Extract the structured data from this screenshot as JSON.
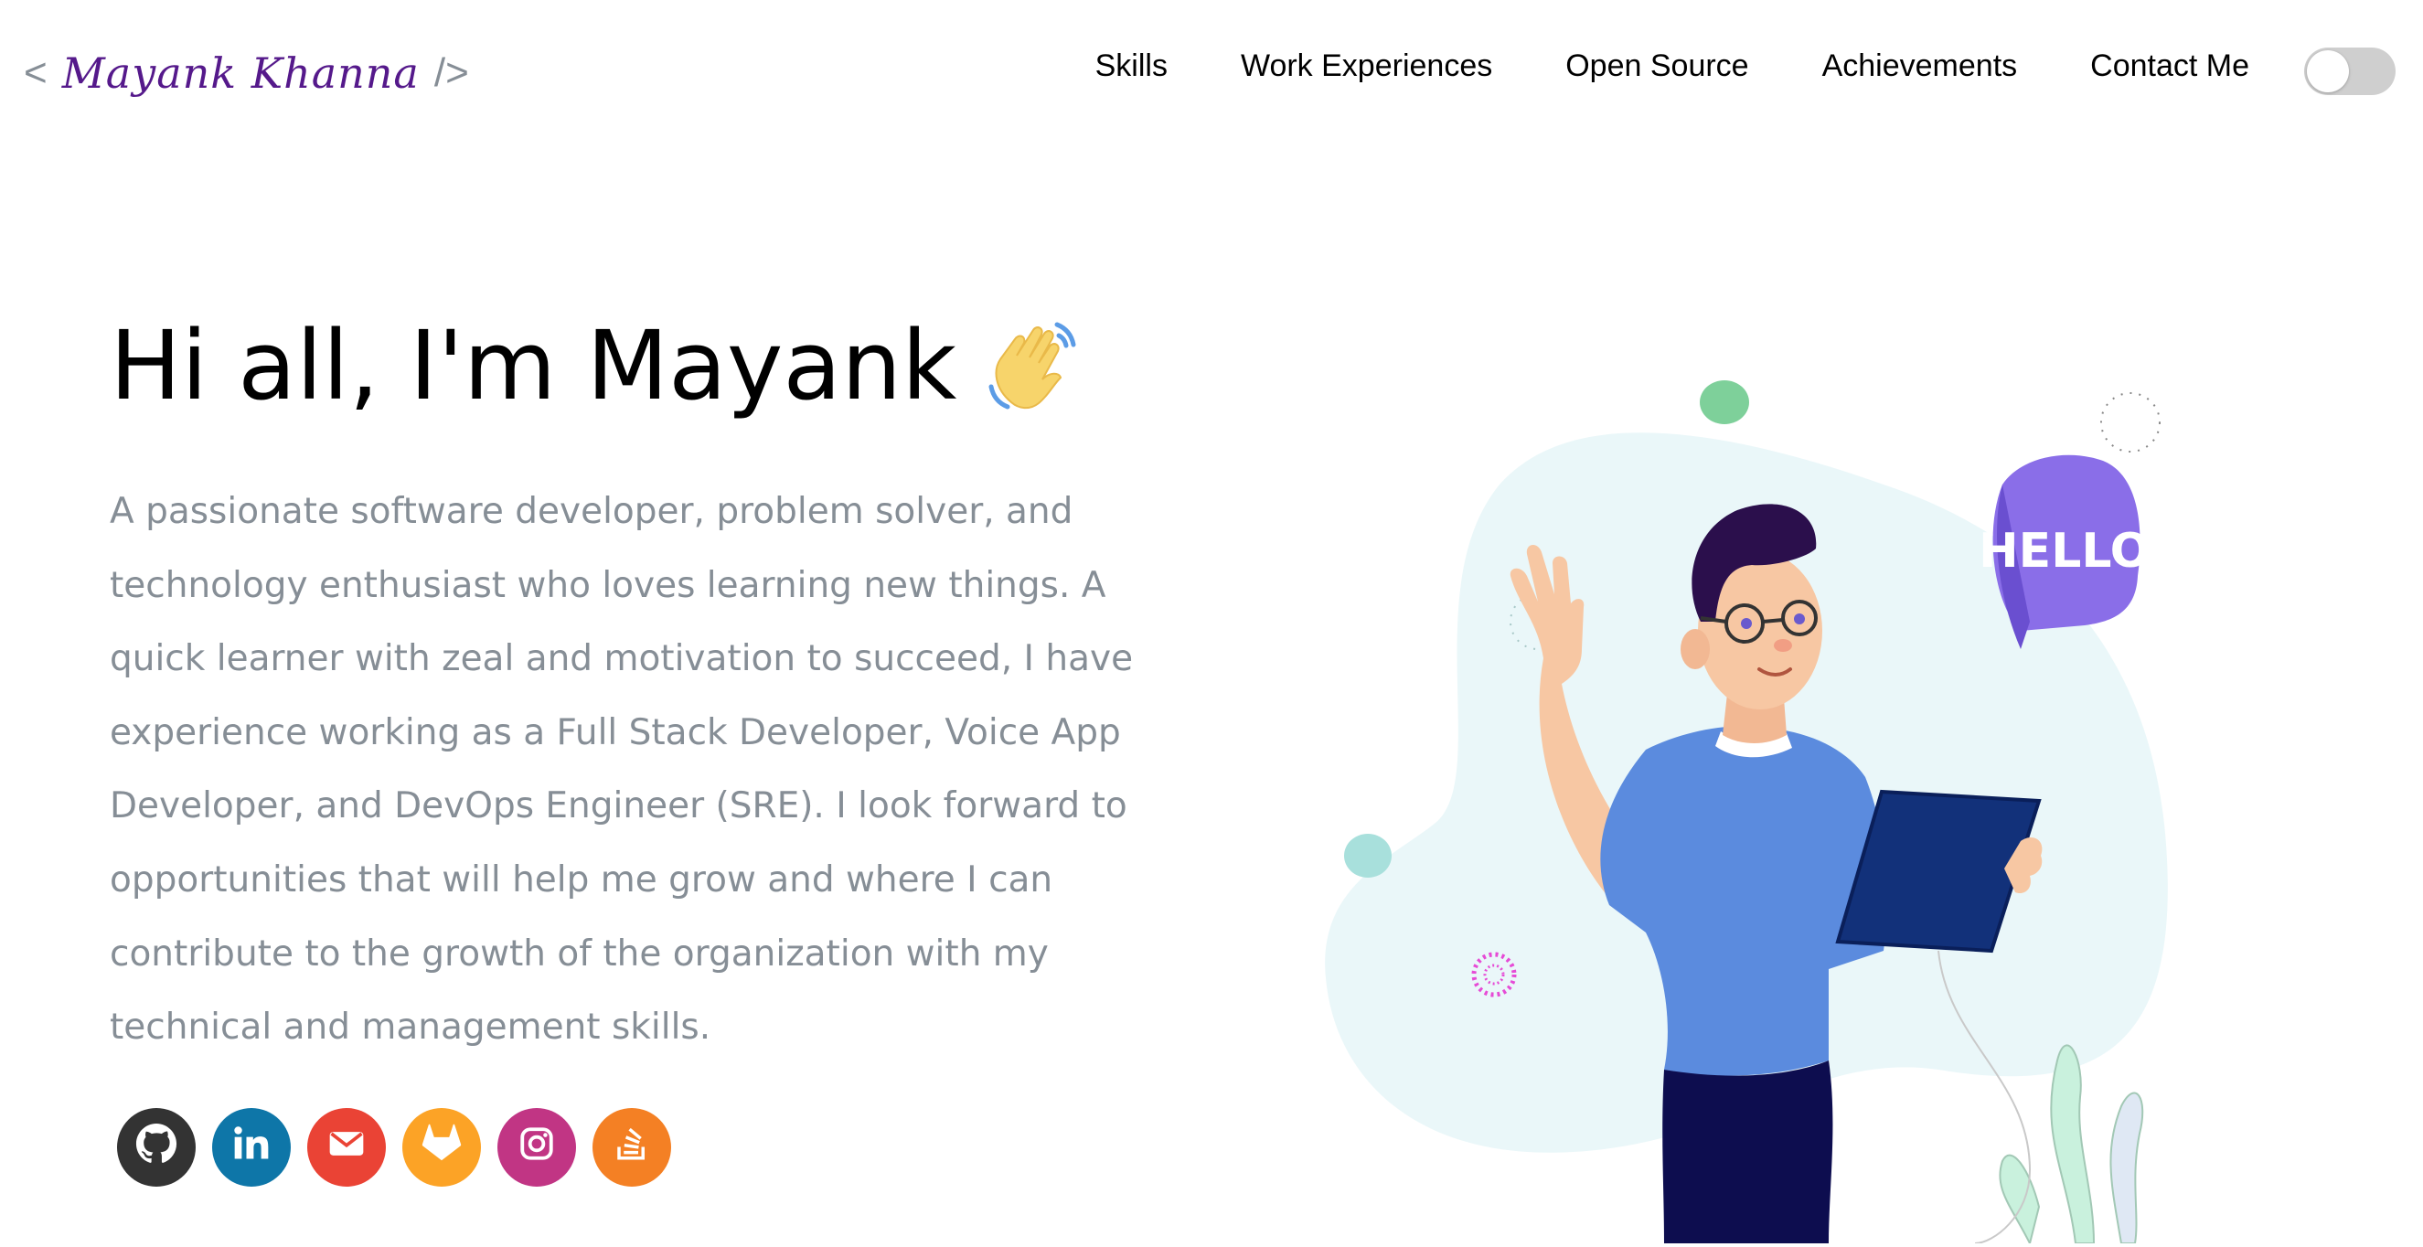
{
  "header": {
    "logo": {
      "open_bracket": "<",
      "name": "Mayank Khanna",
      "close_bracket": "/>"
    },
    "nav": [
      {
        "label": "Skills"
      },
      {
        "label": "Work Experiences"
      },
      {
        "label": "Open Source"
      },
      {
        "label": "Achievements"
      },
      {
        "label": "Contact Me"
      }
    ],
    "theme_toggle": {
      "state": "off",
      "icon": "toggle-switch"
    }
  },
  "greeting": {
    "title": "Hi all, I'm Mayank",
    "wave_icon": "waving-hand-icon",
    "subtitle": "A passionate software developer, problem solver, and technology enthusiast who loves learning new things. A quick learner with zeal and motivation to succeed, I have experience working as a Full Stack Developer, Voice App Developer, and DevOps Engineer (SRE). I look forward to opportunities that will help me grow and where I can contribute to the growth of the organization with my technical and management skills."
  },
  "social": [
    {
      "name": "github",
      "icon": "github-icon",
      "color": "#333333"
    },
    {
      "name": "linkedin",
      "icon": "linkedin-icon",
      "color": "#0e76a8"
    },
    {
      "name": "email",
      "icon": "mail-icon",
      "color": "#ea4335"
    },
    {
      "name": "gitlab",
      "icon": "gitlab-icon",
      "color": "#fca326"
    },
    {
      "name": "instagram",
      "icon": "instagram-icon",
      "color": "#c13584"
    },
    {
      "name": "stackoverflow",
      "icon": "stackoverflow-icon",
      "color": "#f48024"
    }
  ],
  "illustration": {
    "speech_bubble_text": "HELLO",
    "colors": {
      "blob": "#eaf7f9",
      "shirt": "#5b8bde",
      "pants": "#0d0d4f",
      "tablet": "#12317a",
      "bubble": "#8a6ee8",
      "hair": "#2b0f4c",
      "skin": "#f7c7a3"
    }
  },
  "colors": {
    "text": "#000000",
    "subtitle": "#868e96",
    "logo": "#55198b",
    "toggle": "#cfcfcf"
  }
}
